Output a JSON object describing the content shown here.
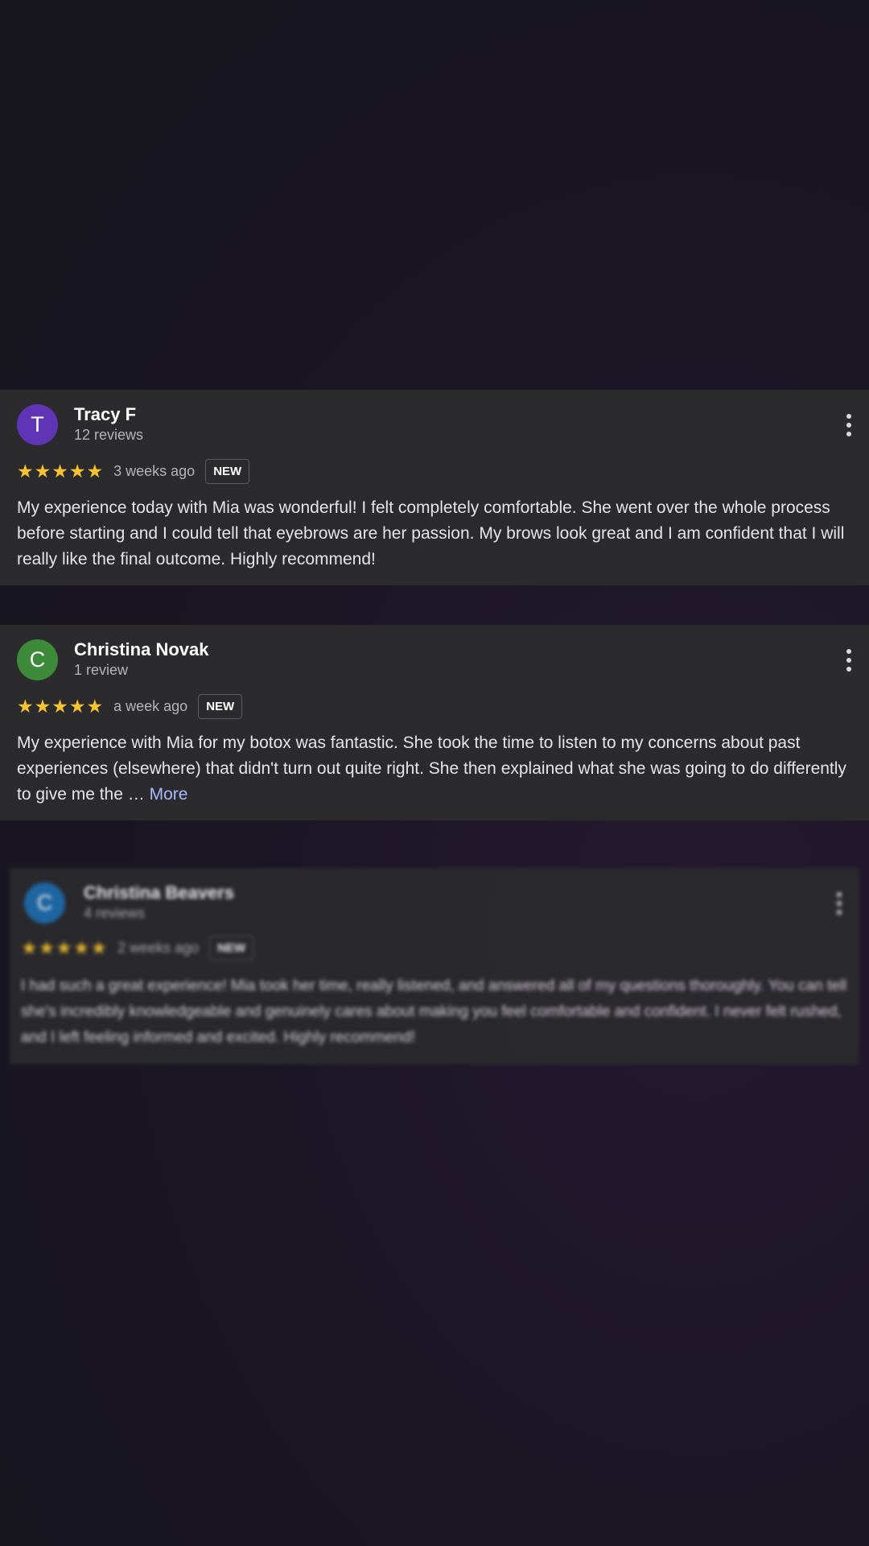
{
  "reviews": [
    {
      "avatar_letter": "T",
      "avatar_color": "#5f35b5",
      "name": "Tracy F",
      "review_count": "12 reviews",
      "stars": "★★★★★",
      "time_ago": "3 weeks ago",
      "badge": "NEW",
      "text": "My experience today with Mia was wonderful! I felt completely comfortable. She went over the whole process before starting and I could tell that eyebrows are her passion. My brows look great and I am confident that I will really like the final outcome. Highly recommend!"
    },
    {
      "avatar_letter": "C",
      "avatar_color": "#3d8a3a",
      "name": "Christina Novak",
      "review_count": "1 review",
      "stars": "★★★★★",
      "time_ago": "a week ago",
      "badge": "NEW",
      "text": "My experience with Mia for my botox was fantastic. She took the time to listen to my concerns about past experiences (elsewhere) that didn't turn out quite right. She then explained what she was going to do differently to give me the … ",
      "more_label": "More"
    },
    {
      "avatar_letter": "C",
      "avatar_color": "#1f6fb0",
      "name": "Christina Beavers",
      "review_count": "4 reviews",
      "stars": "★★★★★",
      "time_ago": "2 weeks ago",
      "badge": "NEW",
      "text": "I had such a great experience! Mia took her time, really listened, and answered all of my questions thoroughly. You can tell she's incredibly knowledgeable and genuinely cares about making you feel comfortable and confident. I never felt rushed, and I left feeling informed and excited. Highly recommend!"
    }
  ],
  "colors": {
    "star": "#f7c32e",
    "card_background": "#2b2b2e",
    "link": "#a9b9ff"
  }
}
